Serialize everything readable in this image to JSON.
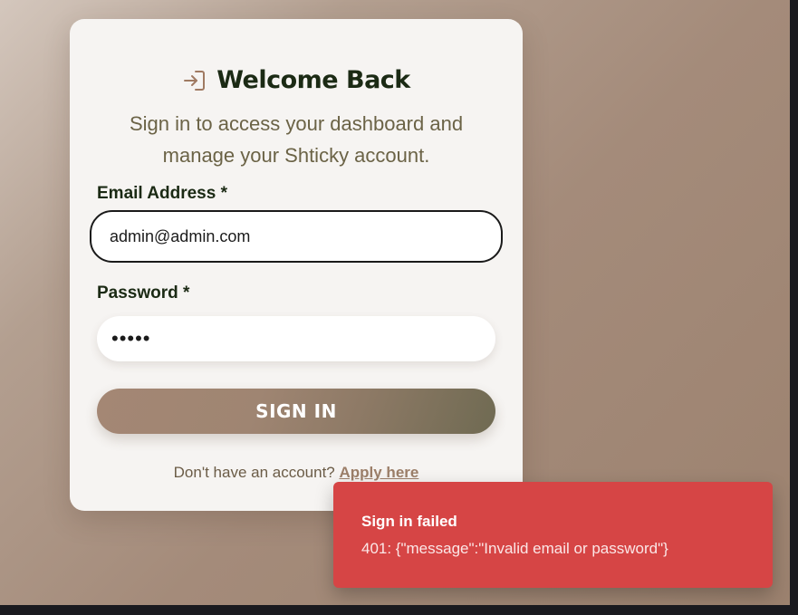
{
  "login": {
    "title": "Welcome Back",
    "title_icon": "login-arrow-icon",
    "subtitle": "Sign in to access your dashboard and manage your Shticky account.",
    "email_label": "Email Address *",
    "email_value": "admin@admin.com",
    "password_label": "Password *",
    "password_value": "•••••",
    "signin_label": "SIGN IN",
    "footer_text": "Don't have an account?",
    "apply_link": "Apply here"
  },
  "toast": {
    "title": "Sign in failed",
    "description": "401: {\"message\":\"Invalid email or password\"}"
  },
  "colors": {
    "card_bg": "#f6f4f2",
    "heading": "#1b2a14",
    "subtitle": "#6b6346",
    "accent": "#9c7f69",
    "toast_bg": "#d64545"
  }
}
